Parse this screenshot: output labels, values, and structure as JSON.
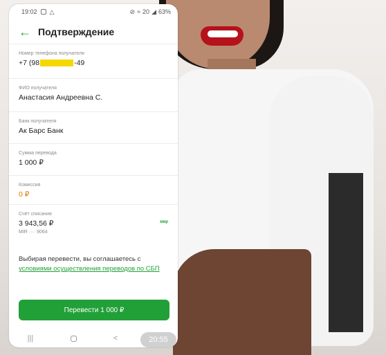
{
  "status": {
    "time": "19:02",
    "battery": "63%",
    "network": "20"
  },
  "header": {
    "title": "Подтверждение"
  },
  "fields": {
    "phone": {
      "label": "Номер телефона получателя",
      "prefix": "+7 (98",
      "suffix": "-49"
    },
    "name": {
      "label": "ФИО получателя",
      "value": "Анастасия Андреевна С."
    },
    "bank": {
      "label": "Банк получателя",
      "value": "Ак Барс Банк"
    },
    "amount": {
      "label": "Сумма перевода",
      "value": "1 000 ₽"
    },
    "fee": {
      "label": "Комиссия",
      "value": "0 ₽"
    },
    "account": {
      "label": "Счёт списания",
      "value": "3 943,56 ₽",
      "card": "МIR ···· 9064",
      "badge": "мир"
    }
  },
  "agreement": {
    "text": "Выбирая перевести, вы соглашаетесь с",
    "link": "условиями осуществления переводов по СБП"
  },
  "button": {
    "label": "Перевести 1 000 ₽"
  },
  "timer": "20:55",
  "colors": {
    "accent": "#21a038",
    "highlight": "#f5d800",
    "fee": "#e07b00"
  }
}
